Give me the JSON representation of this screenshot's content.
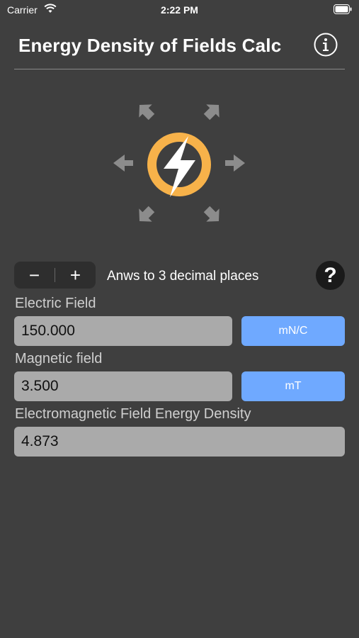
{
  "status": {
    "carrier": "Carrier",
    "time": "2:22 PM"
  },
  "header": {
    "title": "Energy Density of Fields Calc"
  },
  "stepper": {
    "minus": "−",
    "plus": "+"
  },
  "precision": {
    "label": "Anws to 3 decimal places",
    "help": "?"
  },
  "fields": {
    "electric": {
      "label": "Electric Field",
      "value": "150.000",
      "unit": "mN/C"
    },
    "magnetic": {
      "label": "Magnetic field",
      "value": "3.500",
      "unit": "mT"
    },
    "density": {
      "label": "Electromagnetic Field Energy Density",
      "value": "4.873"
    }
  },
  "colors": {
    "background": "#3f3f3f",
    "accent": "#6fa9ff",
    "logo_ring": "#f7b24a",
    "input_bg": "#aaaaaa"
  },
  "icons": [
    "wifi-icon",
    "battery-icon",
    "info-icon",
    "energy-logo-icon",
    "help-icon"
  ]
}
